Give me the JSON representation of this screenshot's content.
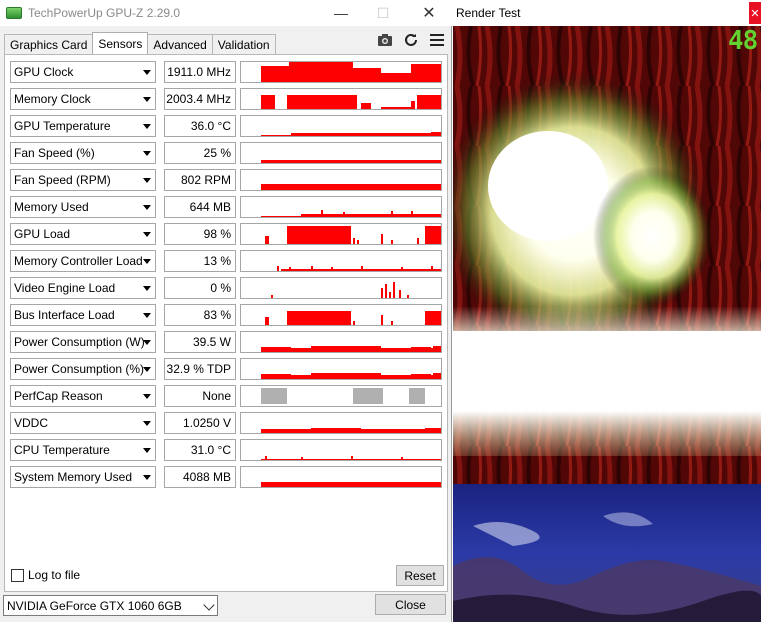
{
  "gpuz": {
    "title": "TechPowerUp GPU-Z 2.29.0",
    "tabs": [
      {
        "label": "Graphics Card",
        "active": false
      },
      {
        "label": "Sensors",
        "active": true
      },
      {
        "label": "Advanced",
        "active": false
      },
      {
        "label": "Validation",
        "active": false
      }
    ],
    "toolbar_icons": [
      "camera-icon",
      "refresh-icon",
      "menu-icon"
    ],
    "sensors": [
      {
        "label": "GPU Clock",
        "value": "1911.0 MHz"
      },
      {
        "label": "Memory Clock",
        "value": "2003.4 MHz"
      },
      {
        "label": "GPU Temperature",
        "value": "36.0 °C"
      },
      {
        "label": "Fan Speed (%)",
        "value": "25 %"
      },
      {
        "label": "Fan Speed (RPM)",
        "value": "802 RPM"
      },
      {
        "label": "Memory Used",
        "value": "644 MB"
      },
      {
        "label": "GPU Load",
        "value": "98 %"
      },
      {
        "label": "Memory Controller Load",
        "value": "13 %"
      },
      {
        "label": "Video Engine Load",
        "value": "0 %"
      },
      {
        "label": "Bus Interface Load",
        "value": "83 %"
      },
      {
        "label": "Power Consumption (W)",
        "value": "39.5 W"
      },
      {
        "label": "Power Consumption (%)",
        "value": "32.9 % TDP"
      },
      {
        "label": "PerfCap Reason",
        "value": "None"
      },
      {
        "label": "VDDC",
        "value": "1.0250 V"
      },
      {
        "label": "CPU Temperature",
        "value": "31.0 °C"
      },
      {
        "label": "System Memory Used",
        "value": "4088 MB"
      }
    ],
    "graph_color": "#ff0000",
    "perfcap_color": "#b0b0b0",
    "log_to_file_label": "Log to file",
    "log_to_file_checked": false,
    "reset_label": "Reset",
    "gpu_select_value": "NVIDIA GeForce GTX 1060 6GB",
    "close_label": "Close"
  },
  "render_test": {
    "title": "Render Test",
    "fps": "48"
  }
}
